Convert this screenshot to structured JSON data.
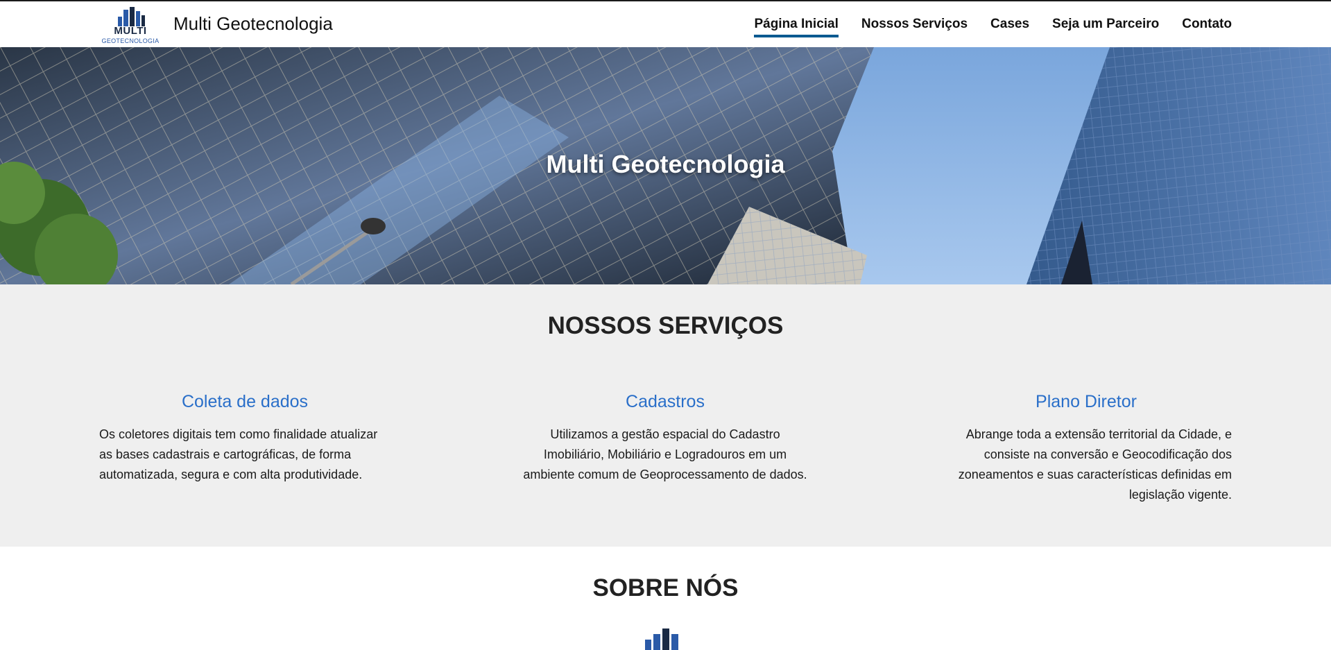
{
  "colors": {
    "nav_active_underline": "#0a5a91",
    "service_heading": "#2a6fc9",
    "logo_dark": "#1a2a44",
    "logo_blue": "#2a5aa8",
    "services_bg": "#efefef"
  },
  "header": {
    "logo": {
      "word": "MULTI",
      "sub": "GEOTECNOLOGIA",
      "icon": "building-bars-icon"
    },
    "brand": "Multi Geotecnologia",
    "nav": [
      {
        "label": "Página Inicial",
        "active": true
      },
      {
        "label": "Nossos Serviços",
        "active": false
      },
      {
        "label": "Cases",
        "active": false
      },
      {
        "label": "Seja um Parceiro",
        "active": false
      },
      {
        "label": "Contato",
        "active": false
      }
    ]
  },
  "hero": {
    "title": "Multi Geotecnologia"
  },
  "services": {
    "title": "NOSSOS SERVIÇOS",
    "items": [
      {
        "title": "Coleta de dados",
        "text": "Os coletores digitais tem como finalidade atualizar as bases cadastrais e cartográficas, de forma automatizada, segura e com alta produtividade."
      },
      {
        "title": "Cadastros",
        "text": "Utilizamos a gestão espacial do Cadastro Imobiliário, Mobiliário e Logradouros em um ambiente comum de Geoprocessamento de dados."
      },
      {
        "title": "Plano Diretor",
        "text": "Abrange toda a extensão territorial da Cidade, e consiste na conversão e Geocodificação dos zoneamentos e suas características definidas em legislação vigente."
      }
    ]
  },
  "about": {
    "title": "SOBRE NÓS",
    "icon": "building-bars-icon"
  }
}
